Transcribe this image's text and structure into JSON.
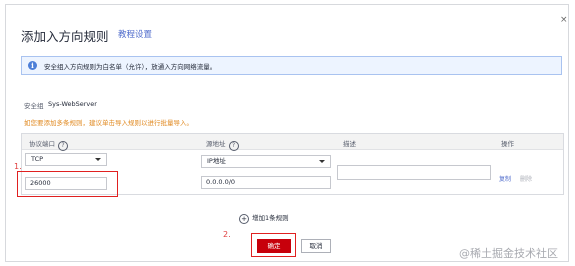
{
  "dialog": {
    "title": "添加入方向规则",
    "tutorial_link": "教程设置",
    "close_glyph": "×"
  },
  "info": {
    "icon": "i",
    "text": "安全组入方向规则为白名单（允许），放通入方向网络流量。"
  },
  "security_group": {
    "label": "安全组",
    "value": "Sys-WebServer"
  },
  "tip": "如您要添加多条规则，建议单击导入规则以进行批量导入。",
  "table": {
    "headers": {
      "protocol_port": "协议端口",
      "source": "源地址",
      "description": "描述",
      "actions": "操作"
    },
    "help_glyph": "?",
    "row": {
      "protocol": "TCP",
      "port": "26000",
      "source_type": "IP地址",
      "source_address": "0.0.0.0/0",
      "description": "",
      "copy": "复制",
      "delete": "删除"
    }
  },
  "annotations": {
    "step1": "1.",
    "step2": "2."
  },
  "add_rule": {
    "icon": "+",
    "label": "增加1条规则"
  },
  "buttons": {
    "ok": "确定",
    "cancel": "取消"
  },
  "watermark": "@稀土掘金技术社区",
  "colors": {
    "primary": "#c7000b",
    "link": "#526ecc",
    "tip": "#e18a22",
    "annotation": "#e02020",
    "info_bg": "#edf4ff"
  }
}
